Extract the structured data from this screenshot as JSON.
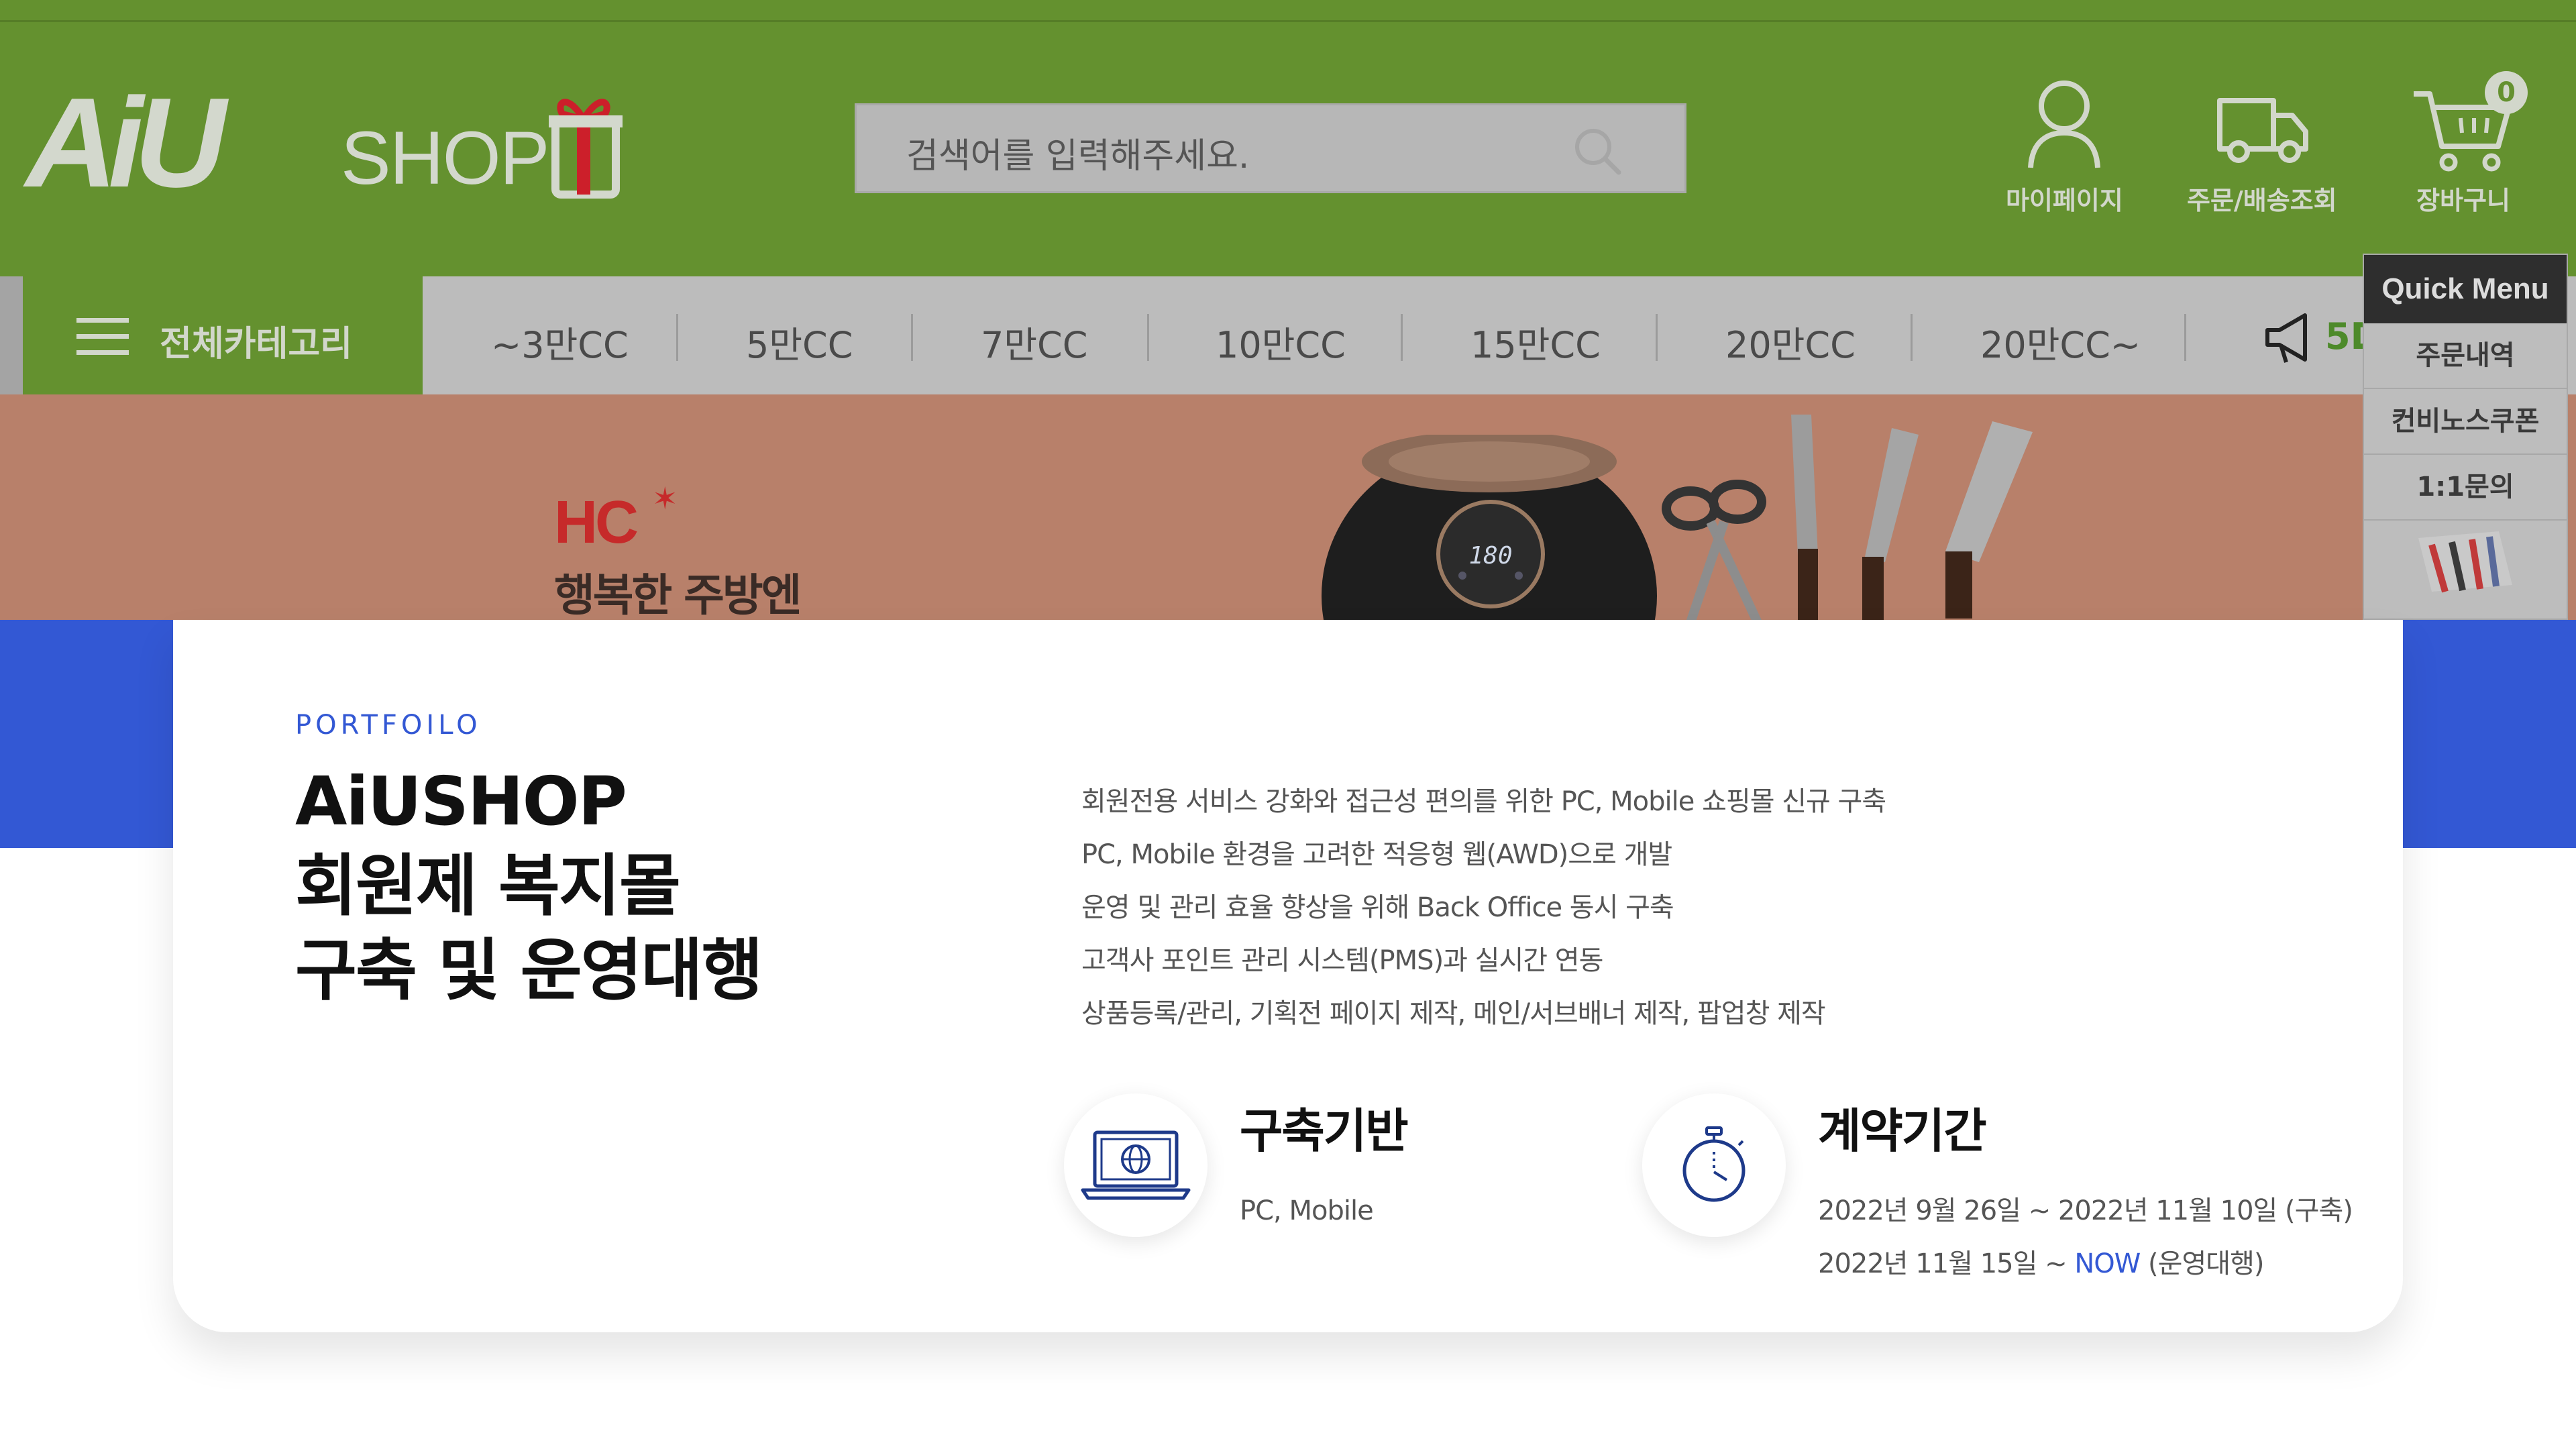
{
  "shop": {
    "logo_text": "AiU",
    "logo_shop": "SHOP",
    "search_placeholder": "검색어를 입력해주세요.",
    "header_icons": {
      "mypage": "마이페이지",
      "order": "주문/배송조회",
      "cart": "장바구니",
      "cart_count": "0"
    },
    "all_category": "전체카테고리",
    "nav_items": [
      "~3만CC",
      "5만CC",
      "7만CC",
      "10만CC",
      "15만CC",
      "20만CC",
      "20만CC~"
    ],
    "notice_partial": "5D",
    "banner": {
      "brand": "HC",
      "tagline": "행복한 주방엔"
    },
    "quick_menu": {
      "title": "Quick Menu",
      "items": [
        "주문내역",
        "컨비노스쿠폰",
        "1:1문의"
      ]
    }
  },
  "portfolio": {
    "eyebrow": "PORTFOILO",
    "title_lines": [
      "AiUSHOP",
      "회원제 복지몰",
      "구축 및 운영대행"
    ],
    "description": [
      "회원전용 서비스 강화와 접근성 편의를 위한 PC, Mobile 쇼핑몰 신규 구축",
      "PC, Mobile 환경을 고려한 적응형 웹(AWD)으로 개발",
      "운영 및 관리 효율 향상을 위해 Back Office 동시 구축",
      "고객사 포인트 관리 시스템(PMS)과 실시간 연동",
      "상품등록/관리, 기획전 페이지 제작, 메인/서브배너 제작, 팝업창 제작"
    ],
    "platform": {
      "title": "구축기반",
      "value": "PC, Mobile"
    },
    "contract": {
      "title": "계약기간",
      "line1": "2022년 9월 26일 ~ 2022년 11월 10일 (구축)",
      "line2_prefix": "2022년 11월 15일 ~ ",
      "line2_now": "NOW",
      "line2_suffix": " (운영대행)"
    }
  },
  "colors": {
    "accent_blue": "#3358d4",
    "shop_green": "#64912f"
  }
}
